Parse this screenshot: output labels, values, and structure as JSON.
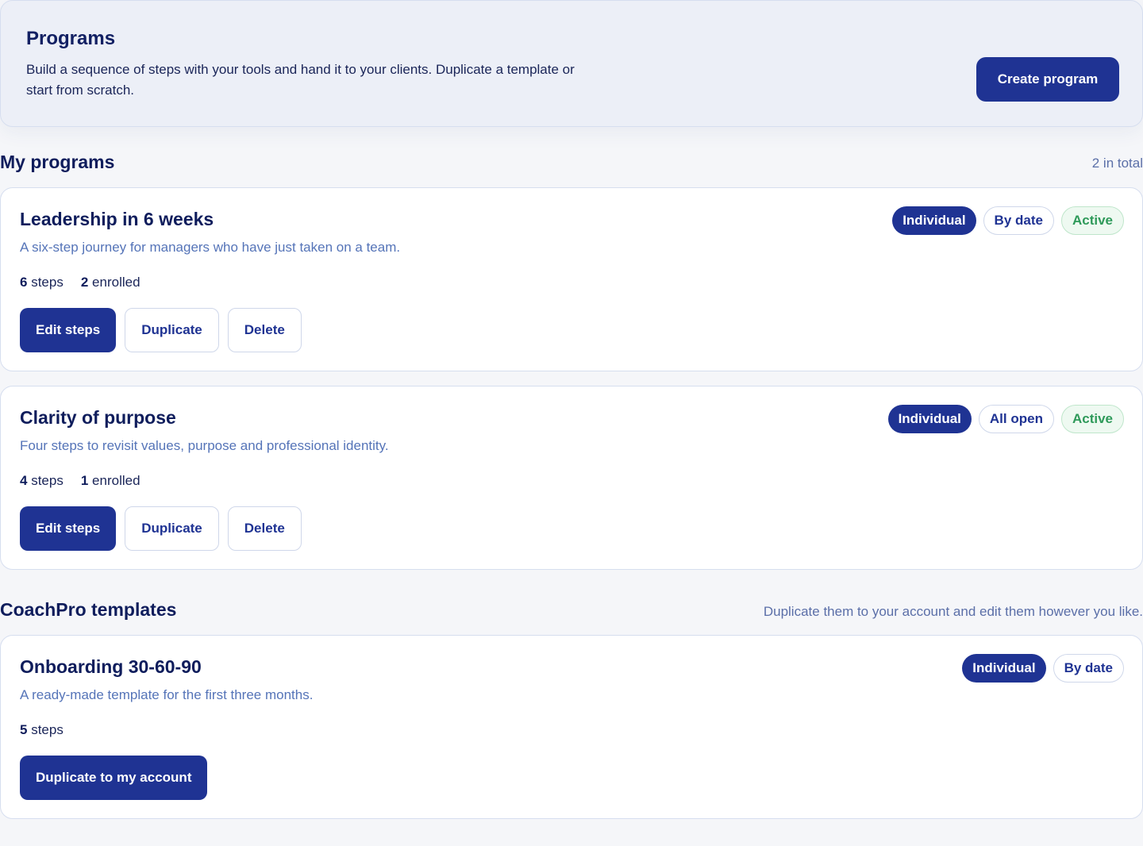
{
  "header": {
    "title": "Programs",
    "description": "Build a sequence of steps with your tools and hand it to your clients. Duplicate a template or start from scratch.",
    "create_label": "Create program"
  },
  "my_programs": {
    "title": "My programs",
    "meta": "2 in total",
    "cards": [
      {
        "title": "Leadership in 6 weeks",
        "description": "A six-step journey for managers who have just taken on a team.",
        "steps_count": "6",
        "steps_label": "steps",
        "enrolled_count": "2",
        "enrolled_label": "enrolled",
        "badges": [
          "Individual",
          "By date",
          "Active"
        ],
        "edit_label": "Edit steps",
        "duplicate_label": "Duplicate",
        "delete_label": "Delete"
      },
      {
        "title": "Clarity of purpose",
        "description": "Four steps to revisit values, purpose and professional identity.",
        "steps_count": "4",
        "steps_label": "steps",
        "enrolled_count": "1",
        "enrolled_label": "enrolled",
        "badges": [
          "Individual",
          "All open",
          "Active"
        ],
        "edit_label": "Edit steps",
        "duplicate_label": "Duplicate",
        "delete_label": "Delete"
      }
    ]
  },
  "templates": {
    "title": "CoachPro templates",
    "meta": "Duplicate them to your account and edit them however you like.",
    "cards": [
      {
        "title": "Onboarding 30-60-90",
        "description": "A ready-made template for the first three months.",
        "steps_count": "5",
        "steps_label": "steps",
        "badges": [
          "Individual",
          "By date"
        ],
        "duplicate_label": "Duplicate to my account"
      }
    ]
  },
  "colors": {
    "primary": "#1f3393",
    "heading": "#0f1d5c",
    "muted": "#5574b8",
    "active_green": "#2f9a5a",
    "border": "#d6deef"
  }
}
